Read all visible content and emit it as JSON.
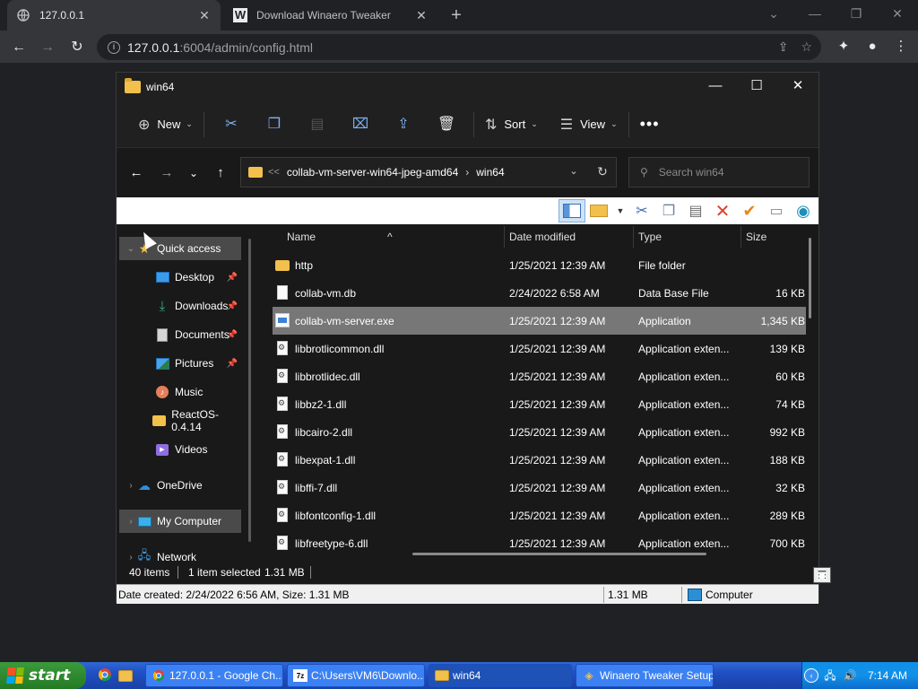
{
  "browser": {
    "tabs": [
      {
        "title": "127.0.0.1",
        "icon": "globe-icon"
      },
      {
        "title": "Download Winaero Tweaker",
        "icon": "winaero-icon"
      }
    ],
    "url_host": "127.0.0.1",
    "url_rest": ":6004/admin/config.html"
  },
  "explorer": {
    "title": "win64",
    "commands": {
      "new_label": "New",
      "sort_label": "Sort",
      "view_label": "View"
    },
    "address": {
      "lead": "<<",
      "part1": "collab-vm-server-win64-jpeg-amd64",
      "part2": "win64"
    },
    "search_placeholder": "Search win64",
    "nav": [
      {
        "label": "Quick access",
        "icon": "star-icon",
        "color": "#f2c14b"
      },
      {
        "label": "Desktop",
        "icon": "desktop-icon",
        "color": "#3b9be8"
      },
      {
        "label": "Downloads",
        "icon": "download-icon",
        "color": "#36b37e"
      },
      {
        "label": "Documents",
        "icon": "documents-icon",
        "color": "#bdbdbd"
      },
      {
        "label": "Pictures",
        "icon": "pictures-icon",
        "color": "#4aa3e8"
      },
      {
        "label": "Music",
        "icon": "music-icon",
        "color": "#e67e5b"
      },
      {
        "label": "ReactOS-0.4.14",
        "icon": "folder-icon",
        "color": "#f2c14b"
      },
      {
        "label": "Videos",
        "icon": "videos-icon",
        "color": "#8e6ee0"
      },
      {
        "label": "OneDrive",
        "icon": "cloud-icon",
        "color": "#2b8fe0"
      },
      {
        "label": "My Computer",
        "icon": "computer-icon",
        "color": "#3bb0e8"
      },
      {
        "label": "Network",
        "icon": "network-icon",
        "color": "#3b9be8"
      }
    ],
    "columns": {
      "name": "Name",
      "date": "Date modified",
      "type": "Type",
      "size": "Size"
    },
    "files": [
      {
        "name": "http",
        "date": "1/25/2021 12:39 AM",
        "type": "File folder",
        "size": ""
      },
      {
        "name": "collab-vm.db",
        "date": "2/24/2022 6:58 AM",
        "type": "Data Base File",
        "size": "16 KB"
      },
      {
        "name": "collab-vm-server.exe",
        "date": "1/25/2021 12:39 AM",
        "type": "Application",
        "size": "1,345 KB"
      },
      {
        "name": "libbrotlicommon.dll",
        "date": "1/25/2021 12:39 AM",
        "type": "Application exten...",
        "size": "139 KB"
      },
      {
        "name": "libbrotlidec.dll",
        "date": "1/25/2021 12:39 AM",
        "type": "Application exten...",
        "size": "60 KB"
      },
      {
        "name": "libbz2-1.dll",
        "date": "1/25/2021 12:39 AM",
        "type": "Application exten...",
        "size": "74 KB"
      },
      {
        "name": "libcairo-2.dll",
        "date": "1/25/2021 12:39 AM",
        "type": "Application exten...",
        "size": "992 KB"
      },
      {
        "name": "libexpat-1.dll",
        "date": "1/25/2021 12:39 AM",
        "type": "Application exten...",
        "size": "188 KB"
      },
      {
        "name": "libffi-7.dll",
        "date": "1/25/2021 12:39 AM",
        "type": "Application exten...",
        "size": "32 KB"
      },
      {
        "name": "libfontconfig-1.dll",
        "date": "1/25/2021 12:39 AM",
        "type": "Application exten...",
        "size": "289 KB"
      },
      {
        "name": "libfreetype-6.dll",
        "date": "1/25/2021 12:39 AM",
        "type": "Application exten...",
        "size": "700 KB"
      }
    ],
    "status": {
      "count": "40 items",
      "selected": "1 item selected",
      "size": "1.31 MB"
    },
    "classic_status": {
      "details": "Date created: 2/24/2022 6:56 AM, Size: 1.31 MB",
      "size": "1.31 MB",
      "location": "Computer"
    }
  },
  "taskbar": {
    "start_label": "start",
    "buttons": [
      {
        "label": "127.0.0.1 - Google Ch...",
        "icon": "chrome-icon"
      },
      {
        "label": "C:\\Users\\VM6\\Downlo...",
        "icon": "7zip-icon"
      },
      {
        "label": "win64",
        "icon": "folder-icon"
      },
      {
        "label": "Winaero Tweaker Setup",
        "icon": "setup-icon"
      }
    ],
    "clock": "7:14 AM"
  }
}
